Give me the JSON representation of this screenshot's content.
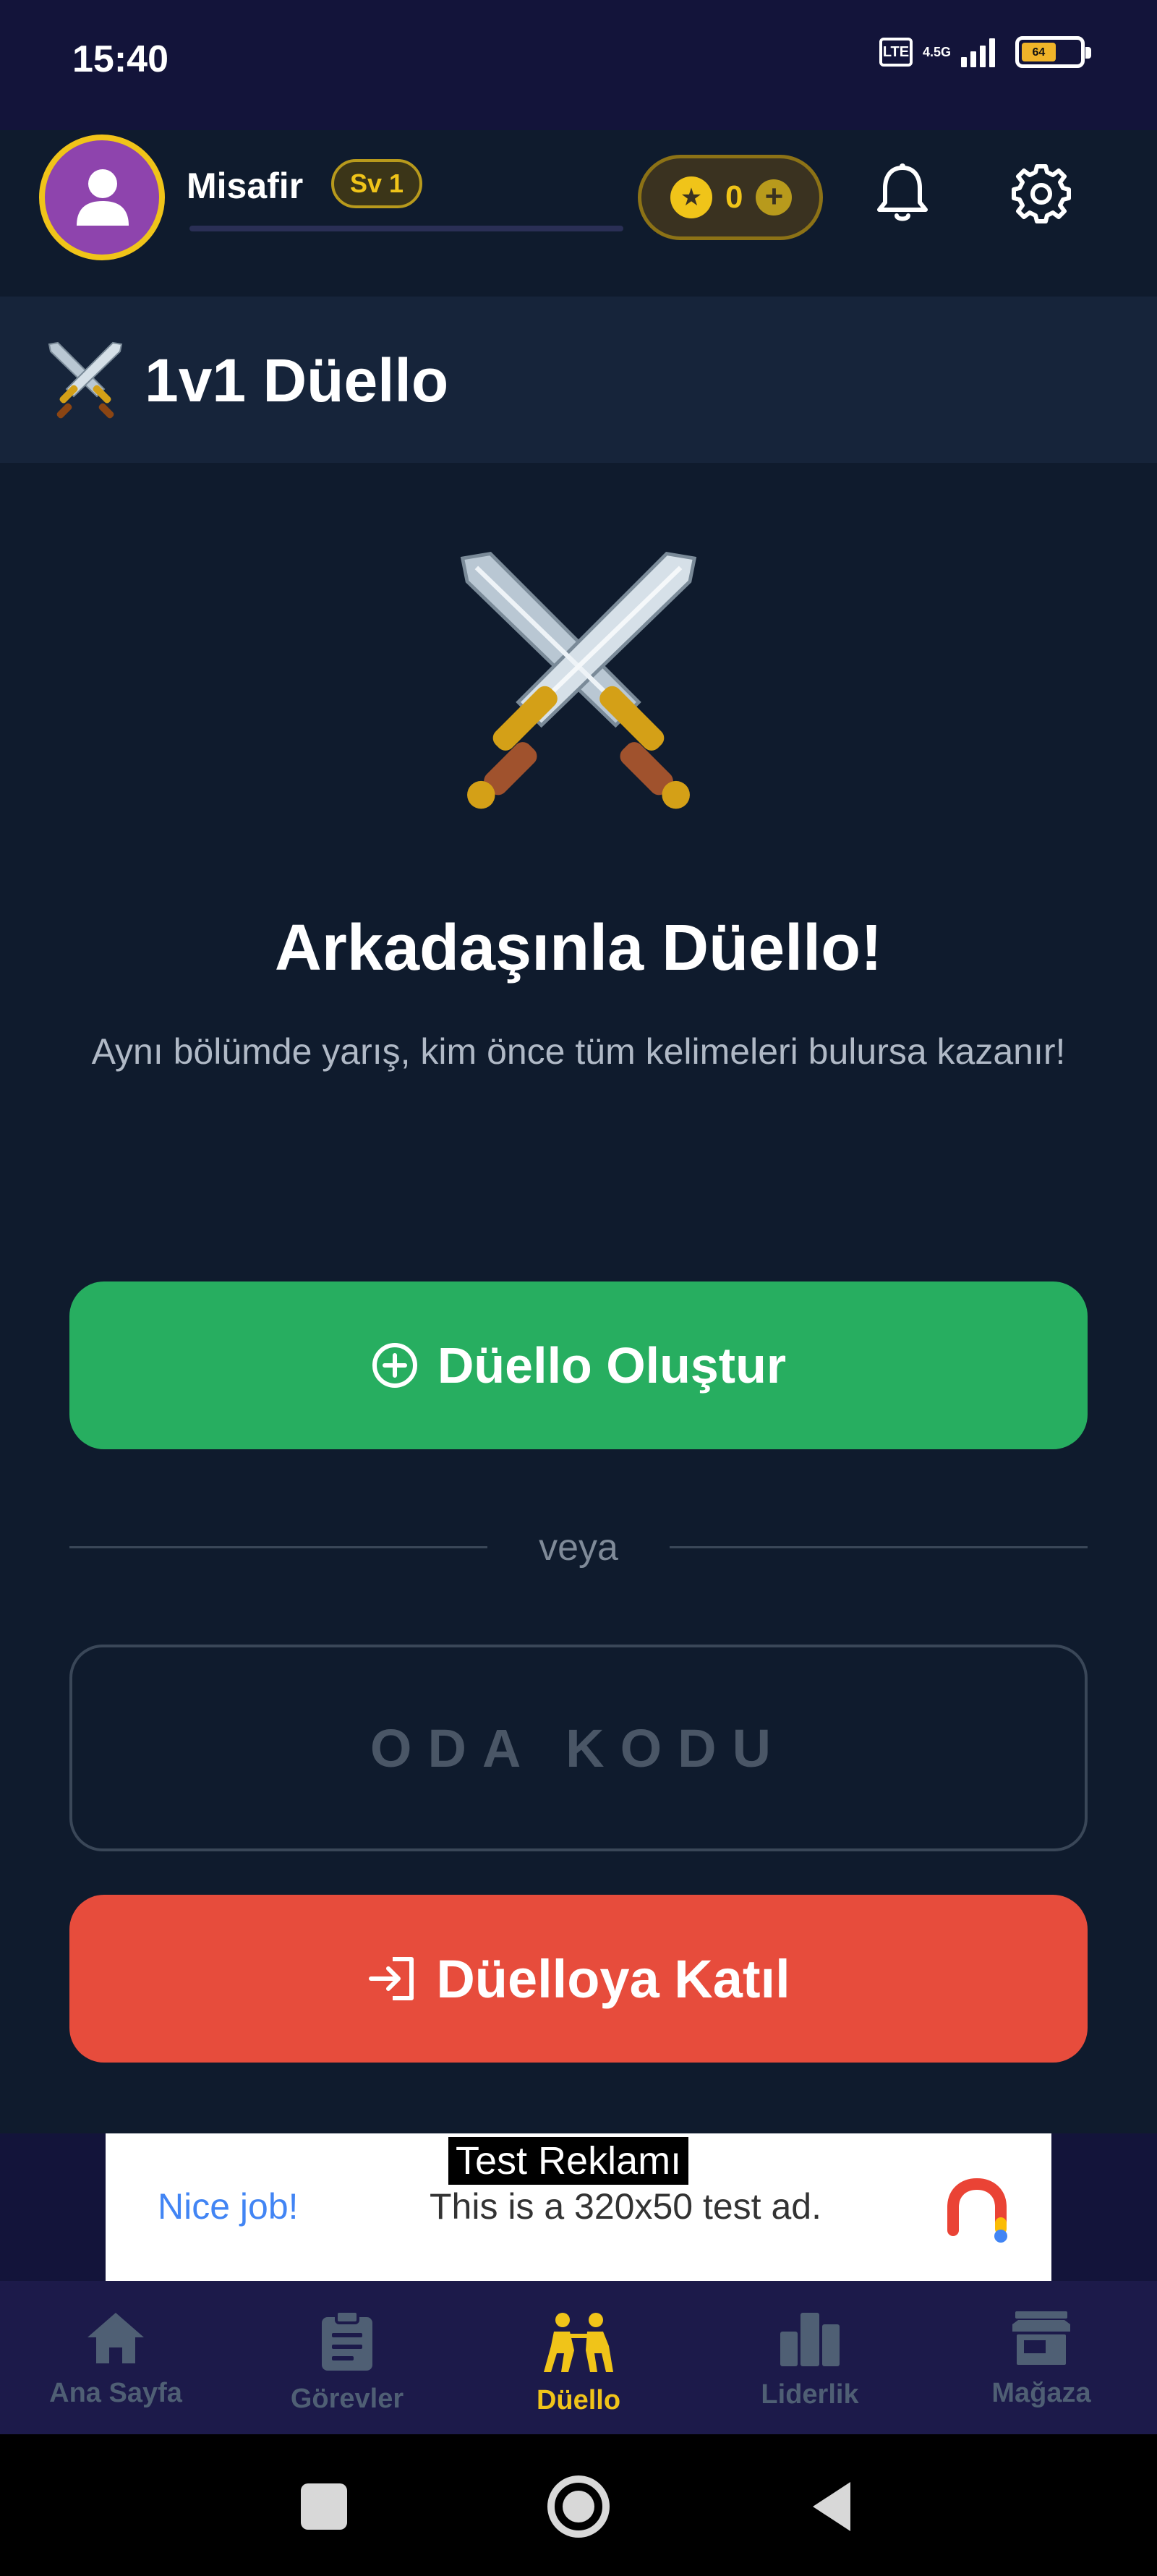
{
  "status_bar": {
    "time": "15:40",
    "sim_label": "LTE",
    "network_label": "4.5G",
    "battery_level": 0.6,
    "battery_label": "64"
  },
  "header": {
    "username": "Misafir",
    "level_badge": "Sv 1",
    "xp_progress": 0,
    "coin_count": "0",
    "avatar_icon": "user-icon",
    "notification_icon": "bell-icon",
    "settings_icon": "gear-icon"
  },
  "page": {
    "title": "1v1 Düello",
    "title_icon": "crossed-swords-icon"
  },
  "hero": {
    "icon": "crossed-swords-icon",
    "title": "Arkadaşınla Düello!",
    "description": "Aynı bölümde yarış, kim önce tüm kelimeleri bulursa kazanır!"
  },
  "actions": {
    "create_label": "Düello Oluştur",
    "divider_text": "veya",
    "room_code_placeholder": "ODA KODU",
    "room_code_value": "",
    "join_label": "Düelloya Katıl"
  },
  "ad": {
    "label": "Test Reklamı",
    "nice_text": "Nice job!",
    "body_text": "This is a 320x50 test ad."
  },
  "bottom_nav": {
    "items": [
      {
        "label": "Ana Sayfa",
        "icon": "home-icon",
        "active": false
      },
      {
        "label": "Görevler",
        "icon": "clipboard-icon",
        "active": false
      },
      {
        "label": "Düello",
        "icon": "duel-icon",
        "active": true
      },
      {
        "label": "Liderlik",
        "icon": "leaderboard-icon",
        "active": false
      },
      {
        "label": "Mağaza",
        "icon": "store-icon",
        "active": false
      }
    ]
  },
  "colors": {
    "background": "#0f1b2d",
    "header_bg": "#13143a",
    "accent_gold": "#f0c419",
    "create_green": "#27ae60",
    "join_red": "#e74c3c",
    "avatar_purple": "#8e44ad"
  }
}
